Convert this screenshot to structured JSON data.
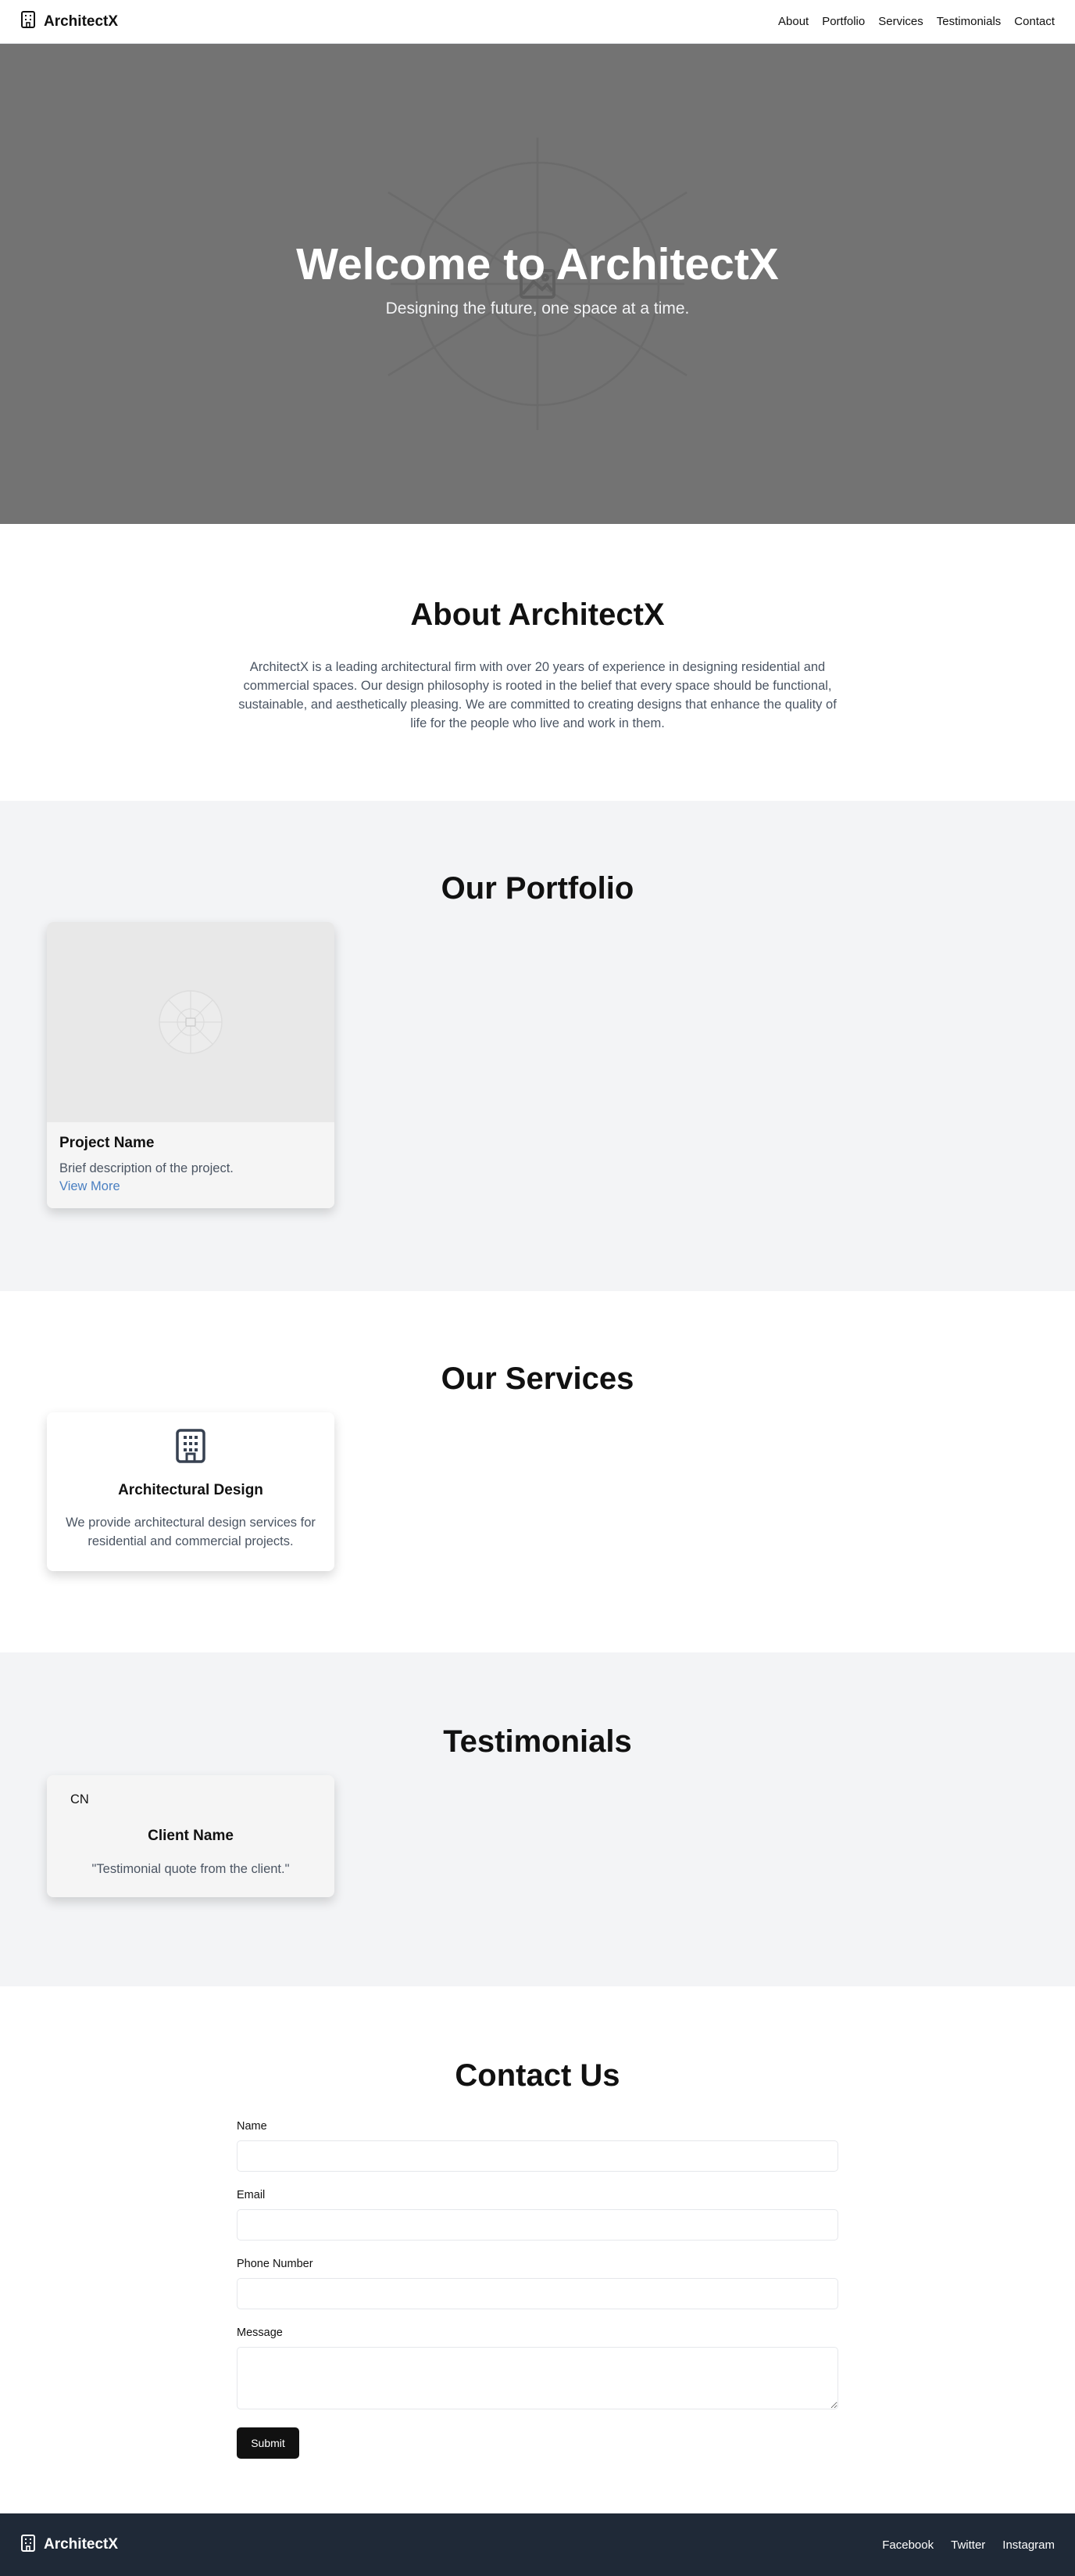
{
  "header": {
    "brand": "ArchitectX",
    "nav": [
      "About",
      "Portfolio",
      "Services",
      "Testimonials",
      "Contact"
    ]
  },
  "hero": {
    "title": "Welcome to ArchitectX",
    "subtitle": "Designing the future, one space at a time."
  },
  "about": {
    "heading": "About ArchitectX",
    "body": "ArchitectX is a leading architectural firm with over 20 years of experience in designing residential and commercial spaces. Our design philosophy is rooted in the belief that every space should be functional, sustainable, and aesthetically pleasing. We are committed to creating designs that enhance the quality of life for the people who live and work in them."
  },
  "portfolio": {
    "heading": "Our Portfolio",
    "items": [
      {
        "title": "Project Name",
        "description": "Brief description of the project.",
        "link": "View More"
      }
    ]
  },
  "services": {
    "heading": "Our Services",
    "items": [
      {
        "icon": "building-icon",
        "title": "Architectural Design",
        "description": "We provide architectural design services for residential and commercial projects."
      }
    ]
  },
  "testimonials": {
    "heading": "Testimonials",
    "items": [
      {
        "avatar": "CN",
        "name": "Client Name",
        "quote": "\"Testimonial quote from the client.\""
      }
    ]
  },
  "contact": {
    "heading": "Contact Us",
    "fields": [
      {
        "label": "Name",
        "value": ""
      },
      {
        "label": "Email",
        "value": ""
      },
      {
        "label": "Phone Number",
        "value": ""
      },
      {
        "label": "Message",
        "value": ""
      }
    ],
    "submit": "Submit"
  },
  "footer": {
    "brand": "ArchitectX",
    "links": [
      "Facebook",
      "Twitter",
      "Instagram"
    ]
  },
  "colors": {
    "hero_bg": "#737373",
    "section_alt_bg": "#f3f4f6",
    "footer_bg": "#1f2937",
    "link": "#4a7fc1",
    "button": "#111111"
  }
}
